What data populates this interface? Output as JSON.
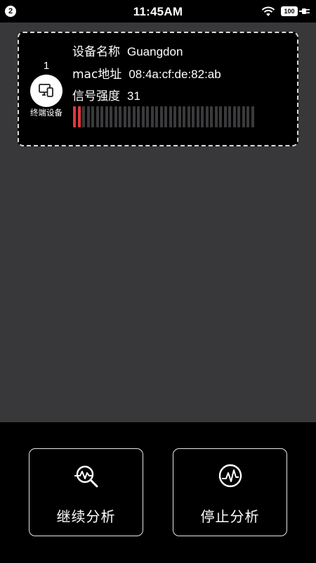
{
  "status_bar": {
    "notification_count": "2",
    "time": "11:45AM",
    "battery_level": "100",
    "icons": [
      "wifi-icon",
      "battery-icon",
      "charging-plug-icon"
    ]
  },
  "device": {
    "index": "1",
    "type_label": "终端设备",
    "icon": "devices-icon",
    "name_label": "设备名称",
    "name_value": "Guangdon",
    "mac_label": "mac地址",
    "mac_value": "08:4a:cf:de:82:ab",
    "signal_label": "信号强度",
    "signal_value": "31",
    "signal_meter": {
      "total_bars": 40,
      "active_bars": 2
    },
    "colors": {
      "signal_active": "#e0383e",
      "signal_inactive": "#3a3a3c"
    }
  },
  "actions": {
    "continue_label": "继续分析",
    "continue_icon": "analysis-search-icon",
    "stop_label": "停止分析",
    "stop_icon": "stop-analysis-icon"
  },
  "colors": {
    "main_background": "#38383a",
    "card_border": "#d8d8d8",
    "bottom_background": "#000000"
  }
}
